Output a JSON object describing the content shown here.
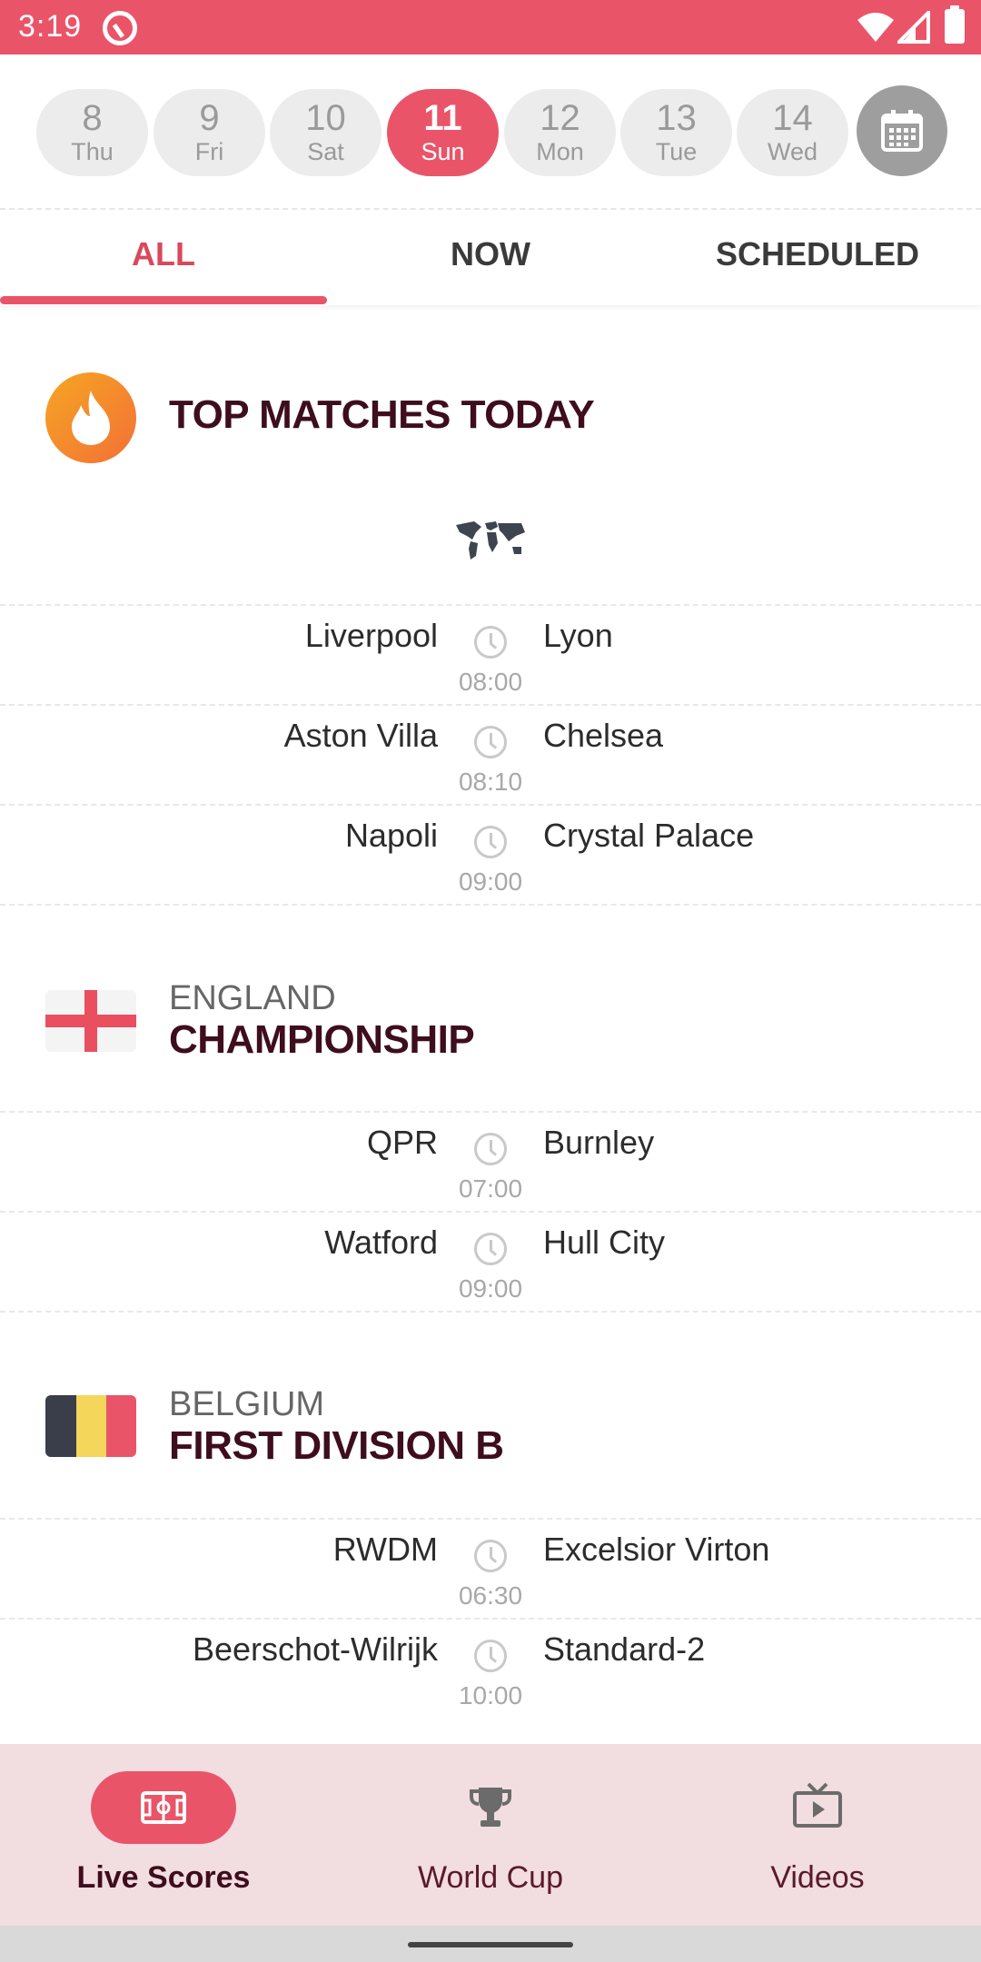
{
  "status_bar": {
    "time": "3:19"
  },
  "dates": [
    {
      "num": "8",
      "weekday": "Thu"
    },
    {
      "num": "9",
      "weekday": "Fri"
    },
    {
      "num": "10",
      "weekday": "Sat"
    },
    {
      "num": "11",
      "weekday": "Sun",
      "selected": true
    },
    {
      "num": "12",
      "weekday": "Mon"
    },
    {
      "num": "13",
      "weekday": "Tue"
    },
    {
      "num": "14",
      "weekday": "Wed"
    }
  ],
  "tabs": [
    {
      "label": "ALL",
      "active": true
    },
    {
      "label": "NOW"
    },
    {
      "label": "SCHEDULED"
    }
  ],
  "sections": {
    "top": {
      "title": "TOP MATCHES TODAY",
      "matches": [
        {
          "home": "Liverpool",
          "away": "Lyon",
          "time": "08:00"
        },
        {
          "home": "Aston Villa",
          "away": "Chelsea",
          "time": "08:10"
        },
        {
          "home": "Napoli",
          "away": "Crystal Palace",
          "time": "09:00"
        }
      ]
    },
    "england": {
      "country": "ENGLAND",
      "league": "CHAMPIONSHIP",
      "matches": [
        {
          "home": "QPR",
          "away": "Burnley",
          "time": "07:00"
        },
        {
          "home": "Watford",
          "away": "Hull City",
          "time": "09:00"
        }
      ]
    },
    "belgium": {
      "country": "BELGIUM",
      "league": "FIRST DIVISION B",
      "matches": [
        {
          "home": "RWDM",
          "away": "Excelsior Virton",
          "time": "06:30"
        },
        {
          "home": "Beerschot-Wilrijk",
          "away": "Standard-2",
          "time": "10:00"
        }
      ]
    }
  },
  "bottom_nav": [
    {
      "label": "Live Scores",
      "icon": "soccer-field-icon",
      "active": true
    },
    {
      "label": "World Cup",
      "icon": "trophy-icon"
    },
    {
      "label": "Videos",
      "icon": "tv-play-icon"
    }
  ],
  "colors": {
    "accent": "#ea5468",
    "title": "#3e0d1e",
    "nav_bg": "#f2dde0"
  }
}
